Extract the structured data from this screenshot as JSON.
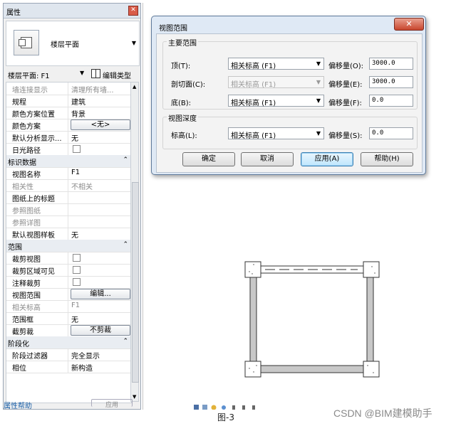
{
  "properties": {
    "title": "属性",
    "close_glyph": "✕",
    "type_name": "楼层平面",
    "selector_value": "楼层平面: F1",
    "edit_type_label": "编辑类型",
    "rows": [
      {
        "kind": "prop",
        "key": "墙连接显示",
        "value": "清理所有墙...",
        "grey": true
      },
      {
        "kind": "prop",
        "key": "规程",
        "value": "建筑"
      },
      {
        "kind": "prop",
        "key": "颜色方案位置",
        "value": "背景"
      },
      {
        "kind": "button",
        "key": "颜色方案",
        "value": "<无>"
      },
      {
        "kind": "prop",
        "key": "默认分析显示...",
        "value": "无"
      },
      {
        "kind": "check",
        "key": "日光路径",
        "value": ""
      },
      {
        "kind": "section",
        "key": "标识数据",
        "value": ""
      },
      {
        "kind": "prop",
        "key": "视图名称",
        "value": "F1"
      },
      {
        "kind": "prop",
        "key": "相关性",
        "value": "不相关",
        "grey": true
      },
      {
        "kind": "prop",
        "key": "图纸上的标题",
        "value": ""
      },
      {
        "kind": "prop",
        "key": "参照图纸",
        "value": "",
        "grey": true
      },
      {
        "kind": "prop",
        "key": "参照详图",
        "value": "",
        "grey": true
      },
      {
        "kind": "prop",
        "key": "默认视图样板",
        "value": "无"
      },
      {
        "kind": "section",
        "key": "范围",
        "value": ""
      },
      {
        "kind": "check",
        "key": "裁剪视图",
        "value": ""
      },
      {
        "kind": "check",
        "key": "裁剪区域可见",
        "value": ""
      },
      {
        "kind": "check",
        "key": "注释裁剪",
        "value": ""
      },
      {
        "kind": "button",
        "key": "视图范围",
        "value": "编辑..."
      },
      {
        "kind": "prop",
        "key": "相关标高",
        "value": "F1",
        "grey": true
      },
      {
        "kind": "prop",
        "key": "范围框",
        "value": "无"
      },
      {
        "kind": "button",
        "key": "截剪裁",
        "value": "不剪裁"
      },
      {
        "kind": "section",
        "key": "阶段化",
        "value": ""
      },
      {
        "kind": "prop",
        "key": "阶段过滤器",
        "value": "完全显示"
      },
      {
        "kind": "prop",
        "key": "相位",
        "value": "新构造"
      }
    ],
    "footer_link": "属性帮助",
    "footer_button": "应用"
  },
  "dialog": {
    "title": "视图范围",
    "close_glyph": "✕",
    "primary_range_label": "主要范围",
    "view_depth_label": "视图深度",
    "fields": [
      {
        "label": "顶(T):",
        "combo": "相关标高 (F1)",
        "offset_label": "偏移量(O):",
        "offset": "3000.0",
        "disabled": false
      },
      {
        "label": "剖切面(C):",
        "combo": "相关标高 (F1)",
        "offset_label": "偏移量(E):",
        "offset": "3000.0",
        "disabled": true
      },
      {
        "label": "底(B):",
        "combo": "相关标高 (F1)",
        "offset_label": "偏移量(F):",
        "offset": "0.0",
        "disabled": false
      },
      {
        "label": "标高(L):",
        "combo": "相关标高 (F1)",
        "offset_label": "偏移量(S):",
        "offset": "0.0",
        "disabled": false
      }
    ],
    "buttons": {
      "ok": "确定",
      "cancel": "取消",
      "apply": "应用(A)",
      "help": "帮助(H)"
    }
  },
  "caption": "图-3",
  "watermark": "CSDN @BIM建模助手"
}
